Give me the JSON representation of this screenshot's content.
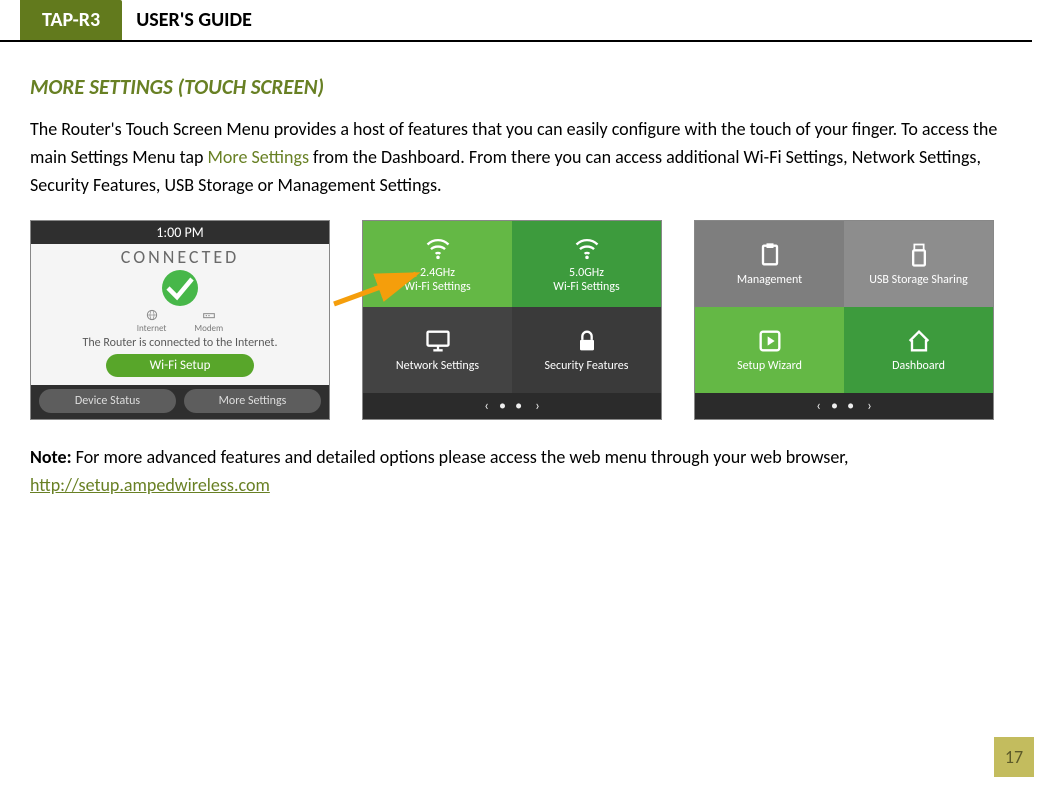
{
  "header": {
    "product": "TAP-R3",
    "title": "USER'S GUIDE"
  },
  "section_title": "MORE SETTINGS (TOUCH SCREEN)",
  "paragraph": {
    "p1a": "The Router's Touch Screen Menu provides a host of features that you can easily configure with the touch of your finger. To access the main Settings Menu tap ",
    "p1b_link": "More Settings",
    "p1c": " from the Dashboard.  From there you can access additional Wi-Fi Settings, Network Settings, Security Features, USB Storage or Management Settings."
  },
  "screen1": {
    "time": "1:00 PM",
    "status_word": "CONNECTED",
    "internet_label": "Internet",
    "modem_label": "Modem",
    "connected_msg": "The Router is connected to the Internet.",
    "wifi_setup": "Wi-Fi Setup",
    "device_status": "Device Status",
    "more_settings": "More Settings"
  },
  "screen2": {
    "tiles": [
      "2.4GHz\nWi-Fi Settings",
      "5.0GHz\nWi-Fi Settings",
      "Network Settings",
      "Security Features"
    ],
    "nav": {
      "left": "‹",
      "dots": "• •",
      "right": "›"
    }
  },
  "screen3": {
    "tiles": [
      "Management",
      "USB Storage Sharing",
      "Setup Wizard",
      "Dashboard"
    ],
    "nav": {
      "left": "‹",
      "dots": "• •",
      "right": "›"
    }
  },
  "note": {
    "label": "Note:",
    "text": " For more advanced features and detailed options please access the web menu through your web browser, ",
    "url": "http://setup.ampedwireless.com"
  },
  "page_number": "17"
}
